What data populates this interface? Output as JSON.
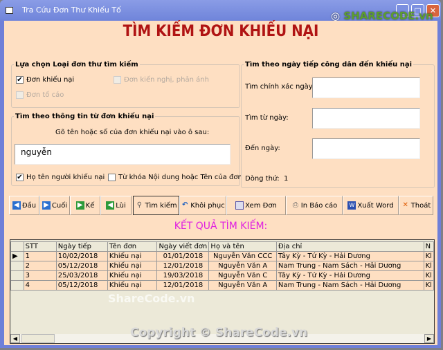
{
  "window": {
    "title": "Tra Cứu Đơn Thư Khiếu Tố",
    "watermark_logo": "SHARECODE.vn"
  },
  "header": {
    "title": "TÌM KIẾM ĐƠN KHIẾU NẠI"
  },
  "type_group": {
    "legend": "Lựa chọn Loại đơn thư tìm kiếm",
    "options": [
      {
        "label": "Đơn khiếu nại",
        "checked": true,
        "enabled": true
      },
      {
        "label": "Đơn kiến nghị, phản ánh",
        "checked": false,
        "enabled": false
      },
      {
        "label": "Đơn tố cáo",
        "checked": false,
        "enabled": false
      }
    ]
  },
  "info_group": {
    "legend": "Tìm theo thông tin từ đơn khiếu nại",
    "hint": "Gõ tên hoặc số của đơn khiếu nại vào ô sau:",
    "search_value": "nguyễn",
    "options": [
      {
        "label": "Họ tên người khiếu nại",
        "checked": true
      },
      {
        "label": "Từ khóa Nội dung hoặc Tên của đơn",
        "checked": false
      }
    ]
  },
  "date_group": {
    "legend": "Tìm theo ngày tiếp công dân đến khiếu nại",
    "exact_label": "Tìm chính xác ngày:",
    "from_label": "Tìm từ ngày:",
    "to_label": "Đến ngày:",
    "exact_value": "",
    "from_value": "",
    "to_value": "",
    "row_label": "Dòng thứ:",
    "row_value": "1"
  },
  "toolbar": {
    "first": "Đầu",
    "last": "Cuối",
    "next": "Kế",
    "prev": "Lùi",
    "search": "Tìm kiếm",
    "restore": "Khôi phục",
    "view": "Xem Đơn",
    "print": "In Báo cáo",
    "export": "Xuất Word",
    "exit": "Thoát"
  },
  "results": {
    "title": "KẾT QUẢ TÌM KIẾM:",
    "columns": [
      "STT",
      "Ngày tiếp",
      "Tên đơn",
      "Ngày viết đơn",
      "Họ và tên",
      "Địa chỉ",
      "N"
    ],
    "rows": [
      [
        "1",
        "10/02/2018",
        "Khiếu nại",
        "01/01/2018",
        "Nguyễn Văn CCC",
        "Tây Kỳ - Tứ Kỳ - Hải Dương",
        "Kl"
      ],
      [
        "2",
        "05/12/2018",
        "Khiếu nại",
        "12/01/2018",
        "Nguyễn Văn A",
        "Nam Trung - Nam Sách - Hải Dương",
        "Kl"
      ],
      [
        "3",
        "25/03/2018",
        "Khiếu nại",
        "19/03/2018",
        "Nguyễn Văn C",
        "Tây Kỳ - Tứ Kỳ - Hải Dương",
        "Kl"
      ],
      [
        "4",
        "05/12/2018",
        "Khiếu nại",
        "12/01/2018",
        "Nguyễn Văn A",
        "Nam Trung - Nam Sách - Hải Dương",
        "Kl"
      ]
    ]
  },
  "watermarks": {
    "center": "ShareCode.vn",
    "footer": "Copyright © ShareCode.vn"
  }
}
